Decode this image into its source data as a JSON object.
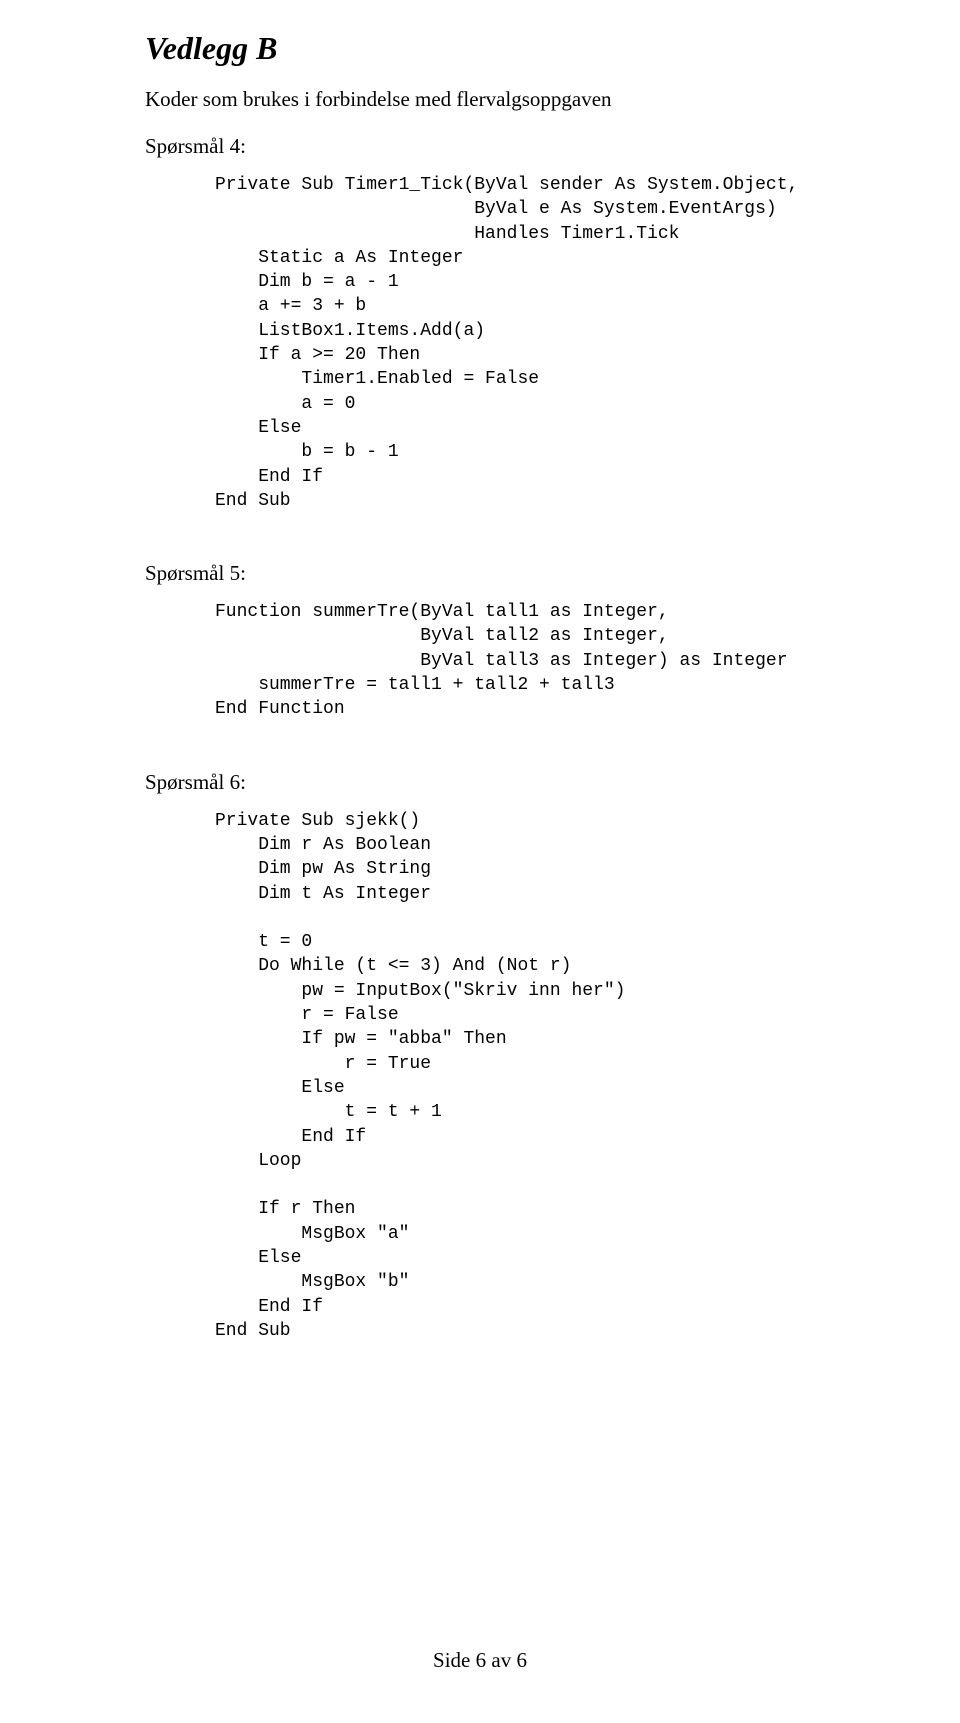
{
  "attachment_title": "Vedlegg B",
  "intro": "Koder som brukes i forbindelse med flervalgsoppgaven",
  "q4": {
    "label": "Spørsmål 4:",
    "code": "Private Sub Timer1_Tick(ByVal sender As System.Object,\n                        ByVal e As System.EventArgs)\n                        Handles Timer1.Tick\n    Static a As Integer\n    Dim b = a - 1\n    a += 3 + b\n    ListBox1.Items.Add(a)\n    If a >= 20 Then\n        Timer1.Enabled = False\n        a = 0\n    Else\n        b = b - 1\n    End If\nEnd Sub"
  },
  "q5": {
    "label": "Spørsmål 5:",
    "code": "Function summerTre(ByVal tall1 as Integer,\n                   ByVal tall2 as Integer,\n                   ByVal tall3 as Integer) as Integer\n    summerTre = tall1 + tall2 + tall3\nEnd Function"
  },
  "q6": {
    "label": "Spørsmål 6:",
    "code": "Private Sub sjekk()\n    Dim r As Boolean\n    Dim pw As String\n    Dim t As Integer\n\n    t = 0\n    Do While (t <= 3) And (Not r)\n        pw = InputBox(\"Skriv inn her\")\n        r = False\n        If pw = \"abba\" Then\n            r = True\n        Else\n            t = t + 1\n        End If\n    Loop\n\n    If r Then\n        MsgBox \"a\"\n    Else\n        MsgBox \"b\"\n    End If\nEnd Sub"
  },
  "footer": "Side 6 av 6"
}
